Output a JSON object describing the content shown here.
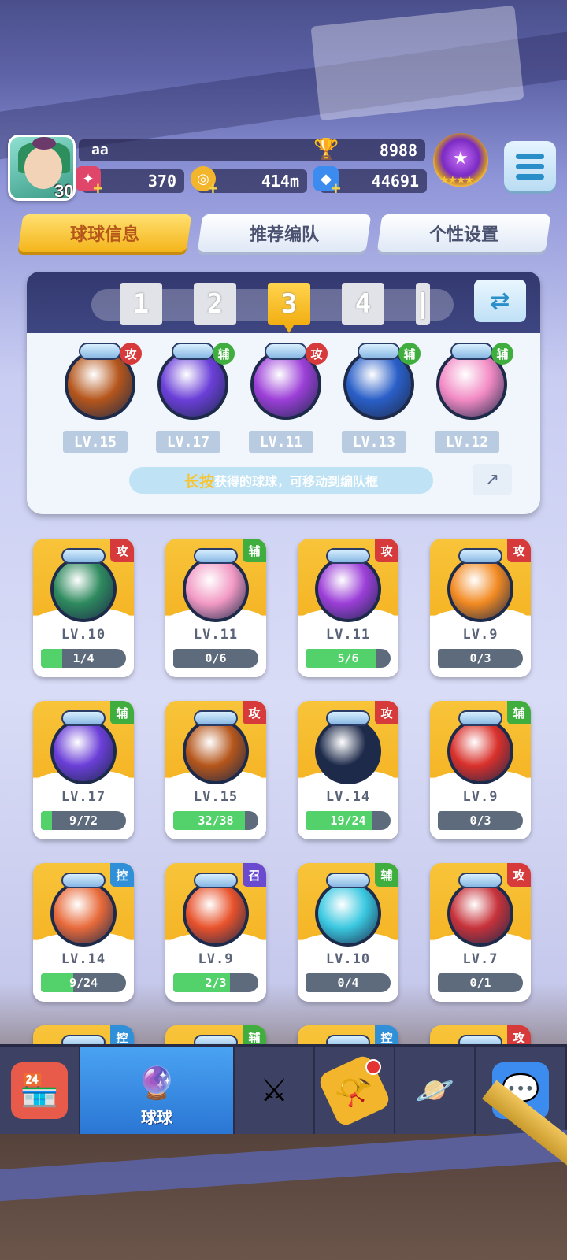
{
  "player": {
    "name": "aa",
    "level": "30",
    "trophies": "8988",
    "energy": "370",
    "distance": "414m",
    "gems": "44691"
  },
  "icons": {
    "trophy": "trophy-icon",
    "energy": "energy-card-icon",
    "coin": "coin-icon",
    "gem": "gem-icon",
    "menu": "menu-icon",
    "swap": "swap-icon",
    "share": "share-icon"
  },
  "tabs": [
    {
      "label": "球球信息",
      "active": true
    },
    {
      "label": "推荐编队",
      "active": false
    },
    {
      "label": "个性设置",
      "active": false
    }
  ],
  "team": {
    "slots": [
      "1",
      "2",
      "3",
      "4",
      "|"
    ],
    "selected_slot": "3",
    "balls": [
      {
        "level": "LV.15",
        "tag": "攻",
        "color": "#b5561b"
      },
      {
        "level": "LV.17",
        "tag": "辅",
        "color": "#6b3fd8"
      },
      {
        "level": "LV.11",
        "tag": "攻",
        "color": "#9c3fd8"
      },
      {
        "level": "LV.13",
        "tag": "辅",
        "color": "#2a5fc8"
      },
      {
        "level": "LV.12",
        "tag": "辅",
        "color": "#f28ac4"
      }
    ],
    "tip_highlight": "长按",
    "tip_text": "获得的球球，可移动到编队框"
  },
  "cards": [
    {
      "type": "攻",
      "level": "LV.10",
      "progress": "1/4",
      "fill": 0.25,
      "color": "#2e8a5e"
    },
    {
      "type": "辅",
      "level": "LV.11",
      "progress": "0/6",
      "fill": 0,
      "color": "#f29ac4"
    },
    {
      "type": "攻",
      "level": "LV.11",
      "progress": "5/6",
      "fill": 0.83,
      "color": "#9c3fd8"
    },
    {
      "type": "攻",
      "level": "LV.9",
      "progress": "0/3",
      "fill": 0,
      "color": "#f28a22"
    },
    {
      "type": "辅",
      "level": "LV.17",
      "progress": "9/72",
      "fill": 0.125,
      "color": "#6b3fd8"
    },
    {
      "type": "攻",
      "level": "LV.15",
      "progress": "32/38",
      "fill": 0.84,
      "color": "#b5561b"
    },
    {
      "type": "攻",
      "level": "LV.14",
      "progress": "19/24",
      "fill": 0.79,
      "color": "#1d2a4a"
    },
    {
      "type": "辅",
      "level": "LV.9",
      "progress": "0/3",
      "fill": 0,
      "color": "#d9302b"
    },
    {
      "type": "控",
      "level": "LV.14",
      "progress": "9/24",
      "fill": 0.375,
      "color": "#e86a3a"
    },
    {
      "type": "召",
      "level": "LV.9",
      "progress": "2/3",
      "fill": 0.67,
      "color": "#e8522b"
    },
    {
      "type": "辅",
      "level": "LV.10",
      "progress": "0/4",
      "fill": 0,
      "color": "#3ac8e0"
    },
    {
      "type": "攻",
      "level": "LV.7",
      "progress": "0/1",
      "fill": 0,
      "color": "#c7323a"
    },
    {
      "type": "控",
      "level": "",
      "progress": "",
      "fill": 0,
      "color": "#f5b526"
    },
    {
      "type": "辅",
      "level": "",
      "progress": "",
      "fill": 0,
      "color": "#f5b526"
    },
    {
      "type": "控",
      "level": "",
      "progress": "",
      "fill": 0,
      "color": "#f5b526"
    },
    {
      "type": "攻",
      "level": "",
      "progress": "",
      "fill": 0,
      "color": "#f5b526"
    }
  ],
  "nav": [
    {
      "name": "shop",
      "label": "",
      "icon": "shop-icon"
    },
    {
      "name": "balls",
      "label": "球球",
      "icon": "ball-icon",
      "active": true
    },
    {
      "name": "battle",
      "label": "",
      "icon": "swords-icon"
    },
    {
      "name": "whistle",
      "label": "",
      "icon": "whistle-icon",
      "badge": true
    },
    {
      "name": "planet",
      "label": "",
      "icon": "planet-icon"
    },
    {
      "name": "social",
      "label": "",
      "icon": "chat-heart-icon"
    }
  ],
  "colors": {
    "attack": "#d63a3a",
    "support": "#3fae3f",
    "control": "#2f8fd8",
    "summon": "#6a4bd0",
    "accent": "#f4b51b"
  }
}
